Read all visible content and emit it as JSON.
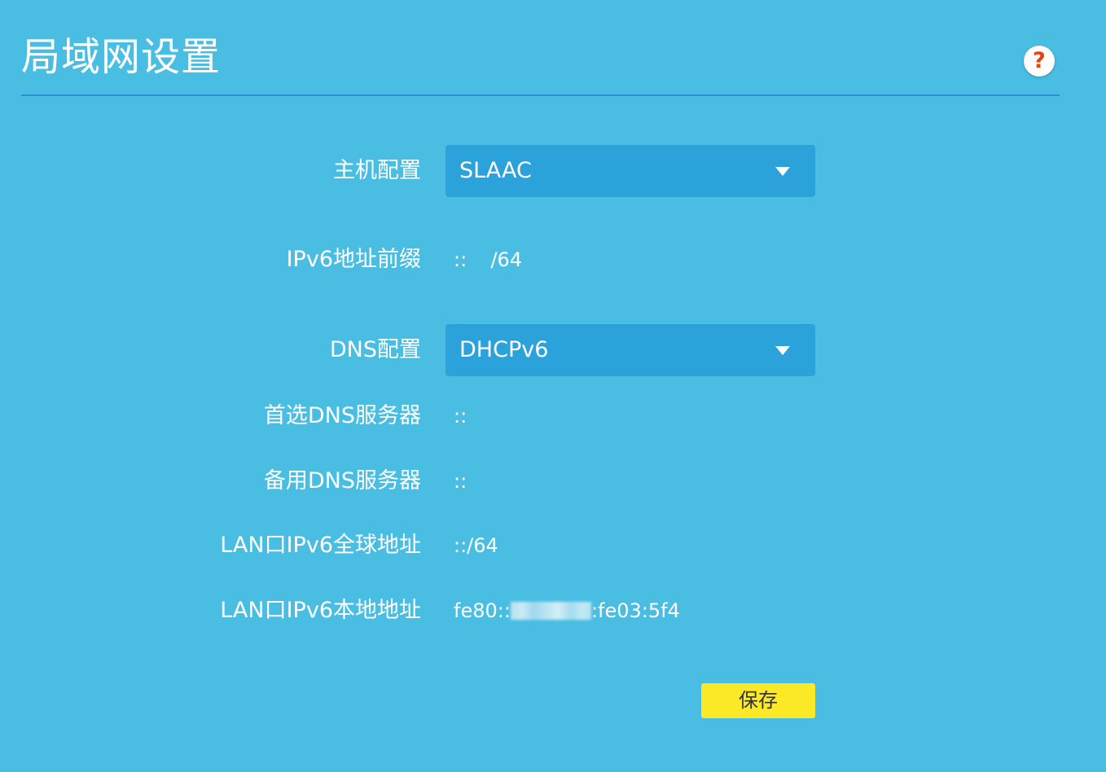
{
  "header": {
    "title": "局域网设置",
    "help_label": "?"
  },
  "form": {
    "host_config": {
      "label": "主机配置",
      "value": "SLAAC"
    },
    "ipv6_prefix": {
      "label": "IPv6地址前缀",
      "value_prefix": "::",
      "value_suffix": "/64"
    },
    "dns_config": {
      "label": "DNS配置",
      "value": "DHCPv6"
    },
    "primary_dns": {
      "label": "首选DNS服务器",
      "value": "::"
    },
    "secondary_dns": {
      "label": "备用DNS服务器",
      "value": "::"
    },
    "lan_global_addr": {
      "label": "LAN口IPv6全球地址",
      "value": "::/64"
    },
    "lan_local_addr": {
      "label": "LAN口IPv6本地地址",
      "value_start": "fe80::",
      "value_end": ":fe03:5f4"
    }
  },
  "actions": {
    "save_label": "保存"
  },
  "colors": {
    "background": "#4abde2",
    "select_bg": "#2ba2da",
    "divider": "#2c8fd6",
    "save_button": "#fbe827",
    "help_icon": "#e8430e"
  },
  "icons": {
    "help": "question-mark-icon",
    "dropdown": "triangle-down-icon"
  }
}
